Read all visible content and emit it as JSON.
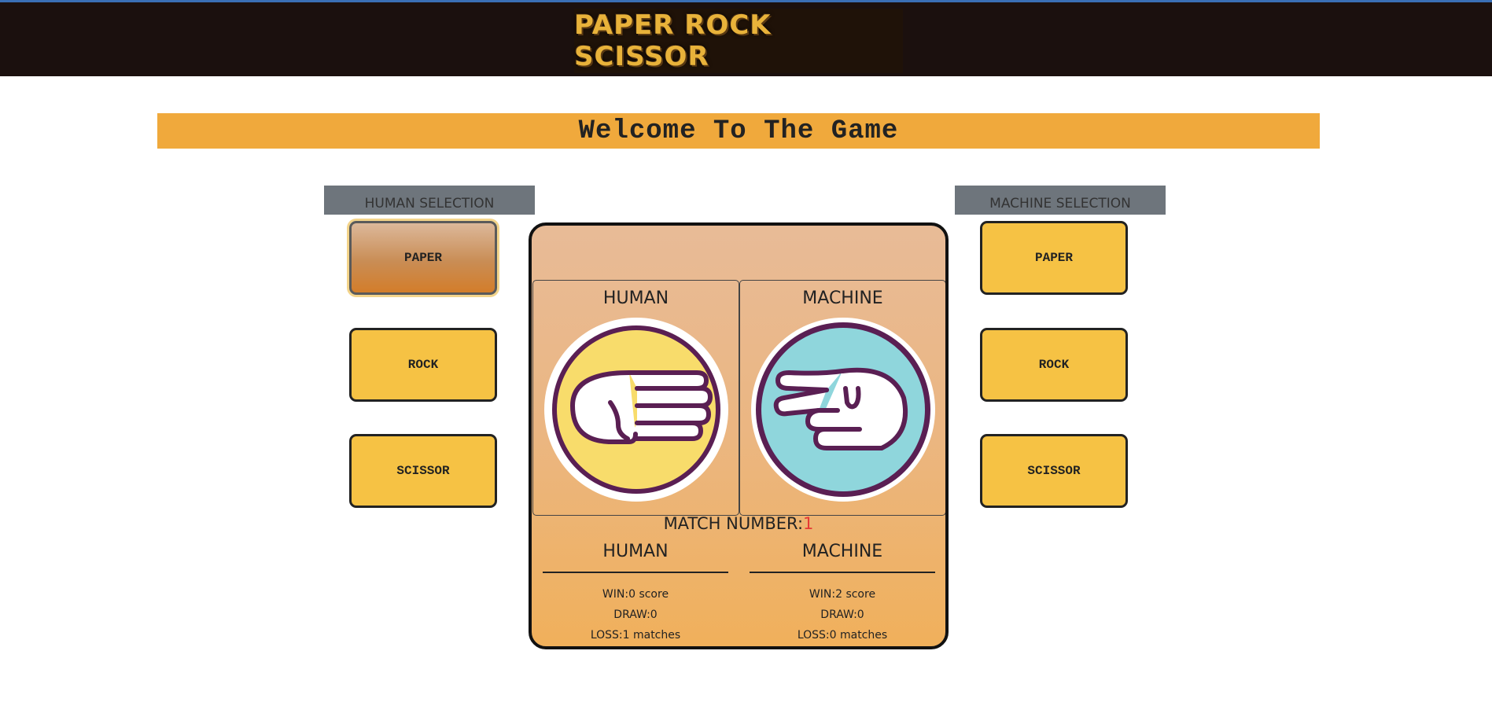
{
  "header": {
    "logo_text": "PAPER ROCK SCISSOR"
  },
  "welcome": "Welcome To The Game",
  "human_selection": {
    "title": "HUMAN SELECTION",
    "options": [
      "PAPER",
      "ROCK",
      "SCISSOR"
    ],
    "selected": "PAPER"
  },
  "machine_selection": {
    "title": "MACHINE SELECTION",
    "options": [
      "PAPER",
      "ROCK",
      "SCISSOR"
    ]
  },
  "board": {
    "human_label": "HUMAN",
    "machine_label": "MACHINE",
    "human_hand_icon": "paper-hand-icon",
    "machine_hand_icon": "scissor-hand-icon",
    "human_circle_color": "#f8dc6b",
    "machine_circle_color": "#8fd6dc",
    "outline_color": "#5a1f53",
    "match_label": "MATCH NUMBER:",
    "match_number": "1"
  },
  "scores": {
    "human": {
      "title": "HUMAN",
      "win": "WIN:0 score",
      "draw": "DRAW:0",
      "loss": "LOSS:1 matches"
    },
    "machine": {
      "title": "MACHINE",
      "win": "WIN:2 score",
      "draw": "DRAW:0",
      "loss": "LOSS:0 matches"
    }
  },
  "colors": {
    "accent": "#f0a93c",
    "button": "#f6c244",
    "header_bg": "#1b100e",
    "selection_header": "#6e757c"
  }
}
